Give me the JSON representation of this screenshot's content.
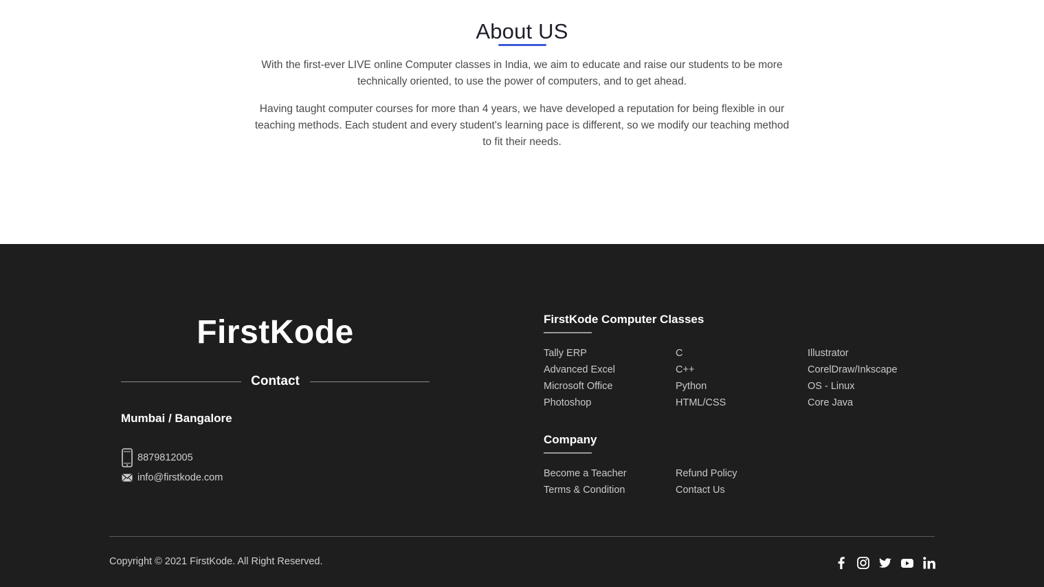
{
  "about": {
    "title": "About US",
    "paragraph1": "With the first-ever LIVE online Computer classes in India, we aim to educate and raise our students to be more technically oriented, to use the power of computers, and to get ahead.",
    "paragraph2": "Having taught computer courses for more than 4 years, we have developed a reputation for being flexible in our teaching methods. Each student and every student's learning pace is different, so we modify our teaching method to fit their needs."
  },
  "footer": {
    "brand": "FirstKode",
    "contact_label": "Contact",
    "city": "Mumbai / Bangalore",
    "phone": "8879812005",
    "email": "info@firstkode.com",
    "classes_title": "FirstKode Computer Classes",
    "classes": [
      "Tally ERP",
      "Advanced Excel",
      "Microsoft Office",
      "Photoshop",
      "C",
      "C++",
      "Python",
      "HTML/CSS",
      "Illustrator",
      "CorelDraw/Inkscape",
      "OS - Linux",
      "Core Java"
    ],
    "company_title": "Company",
    "company_links": [
      "Become a Teacher",
      "Terms & Condition",
      "Refund Policy",
      "Contact Us"
    ],
    "copyright": "Copyright © 2021 FirstKode. All Right Reserved.",
    "social_icons": [
      "facebook-icon",
      "instagram-icon",
      "twitter-icon",
      "youtube-icon",
      "linkedin-icon"
    ]
  },
  "colors": {
    "accent": "#3a5bd9",
    "footer_bg": "#1e1e1e"
  }
}
